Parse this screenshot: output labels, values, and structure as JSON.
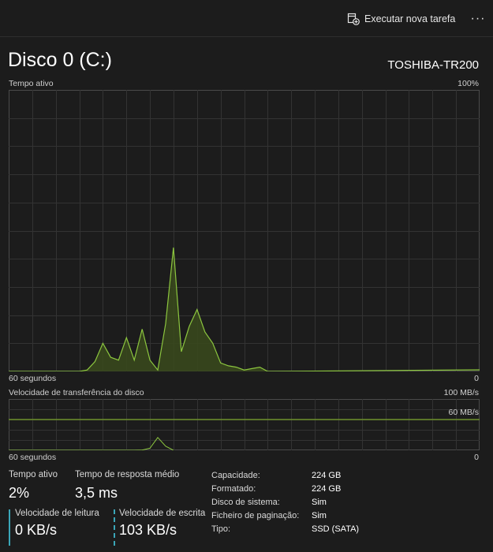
{
  "toolbar": {
    "run_task_label": "Executar nova tarefa",
    "more_label": "···"
  },
  "header": {
    "title": "Disco 0 (C:)",
    "model": "TOSHIBA-TR200"
  },
  "active_time_graph": {
    "label": "Tempo ativo",
    "max_label": "100%",
    "x_left_label": "60 segundos",
    "x_right_label": "0",
    "line_color": "#8cc63f",
    "fill_color": "#3a4a1c"
  },
  "transfer_graph": {
    "label": "Velocidade de transferência do disco",
    "max_label": "100 MB/s",
    "ref_label": "60 MB/s",
    "x_left_label": "60 segundos",
    "x_right_label": "0",
    "ref_line_color": "#7aa32a"
  },
  "chart_data": [
    {
      "type": "area",
      "title": "Tempo ativo",
      "ylim": [
        0,
        100
      ],
      "xlim": [
        60,
        0
      ],
      "grid": true,
      "series": [
        {
          "values": [
            [
              60,
              0
            ],
            [
              51,
              0
            ],
            [
              50,
              0.5
            ],
            [
              49,
              3.5
            ],
            [
              48,
              10
            ],
            [
              47,
              5
            ],
            [
              46,
              4
            ],
            [
              45,
              12
            ],
            [
              44,
              4
            ],
            [
              43,
              15
            ],
            [
              42,
              4
            ],
            [
              41,
              0.5
            ],
            [
              40,
              17
            ],
            [
              39,
              44
            ],
            [
              38,
              7
            ],
            [
              37,
              16
            ],
            [
              36,
              22
            ],
            [
              35,
              14
            ],
            [
              34,
              10
            ],
            [
              33,
              3
            ],
            [
              32,
              2
            ],
            [
              31,
              1.5
            ],
            [
              30,
              0.5
            ],
            [
              29,
              1
            ],
            [
              28,
              1.5
            ],
            [
              27,
              0
            ]
          ]
        }
      ]
    },
    {
      "type": "line",
      "title": "Velocidade de transferência do disco",
      "ylim": [
        0,
        100
      ],
      "ylabel": "MB/s",
      "reference_line": 60,
      "series": [
        {
          "values": [
            [
              60,
              0
            ],
            [
              44,
              0
            ],
            [
              43,
              0.5
            ],
            [
              42,
              4
            ],
            [
              41,
              25
            ],
            [
              40,
              8
            ],
            [
              39,
              0
            ]
          ]
        }
      ]
    }
  ],
  "stats": {
    "active_time_label": "Tempo ativo",
    "active_time_value": "2%",
    "avg_response_label": "Tempo de resposta médio",
    "avg_response_value": "3,5 ms",
    "read_speed_label": "Velocidade de leitura",
    "read_speed_value": "0 KB/s",
    "write_speed_label": "Velocidade de escrita",
    "write_speed_value": "103 KB/s",
    "read_color": "#3aa6b8",
    "write_color": "#3aa6b8"
  },
  "properties": [
    {
      "label": "Capacidade:",
      "value": "224 GB"
    },
    {
      "label": "Formatado:",
      "value": "224 GB"
    },
    {
      "label": "Disco de sistema:",
      "value": "Sim"
    },
    {
      "label": "Ficheiro de paginação:",
      "value": "Sim"
    },
    {
      "label": "Tipo:",
      "value": "SSD (SATA)"
    }
  ]
}
